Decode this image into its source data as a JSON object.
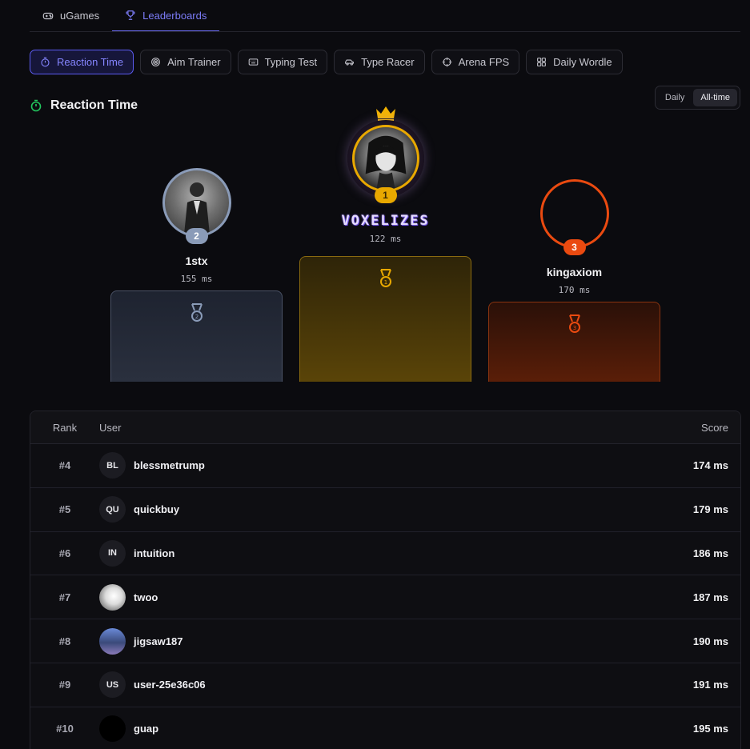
{
  "nav": {
    "items": [
      {
        "label": "uGames",
        "icon": "gamepad-icon"
      },
      {
        "label": "Leaderboards",
        "icon": "trophy-icon"
      }
    ]
  },
  "games": [
    {
      "label": "Reaction Time",
      "icon": "stopwatch-icon"
    },
    {
      "label": "Aim Trainer",
      "icon": "target-icon"
    },
    {
      "label": "Typing Test",
      "icon": "keyboard-icon"
    },
    {
      "label": "Type Racer",
      "icon": "car-icon"
    },
    {
      "label": "Arena FPS",
      "icon": "crosshair-icon"
    },
    {
      "label": "Daily Wordle",
      "icon": "grid-icon"
    }
  ],
  "section": {
    "title": "Reaction Time",
    "period_options": [
      "Daily",
      "All-time"
    ],
    "period_selected": "All-time"
  },
  "podium": {
    "first": {
      "rank": "1",
      "name": "VOXELIZES",
      "score": "122 ms"
    },
    "second": {
      "rank": "2",
      "name": "1stx",
      "score": "155 ms"
    },
    "third": {
      "rank": "3",
      "name": "kingaxiom",
      "score": "170 ms"
    }
  },
  "table": {
    "headers": {
      "rank": "Rank",
      "user": "User",
      "score": "Score"
    },
    "rows": [
      {
        "rank": "#4",
        "initials": "BL",
        "user": "blessmetrump",
        "score": "174 ms"
      },
      {
        "rank": "#5",
        "initials": "QU",
        "user": "quickbuy",
        "score": "179 ms"
      },
      {
        "rank": "#6",
        "initials": "IN",
        "user": "intuition",
        "score": "186 ms"
      },
      {
        "rank": "#7",
        "initials": "",
        "user": "twoo",
        "score": "187 ms"
      },
      {
        "rank": "#8",
        "initials": "",
        "user": "jigsaw187",
        "score": "190 ms"
      },
      {
        "rank": "#9",
        "initials": "US",
        "user": "user-25e36c06",
        "score": "191 ms"
      },
      {
        "rank": "#10",
        "initials": "",
        "user": "guap",
        "score": "195 ms"
      }
    ]
  },
  "colors": {
    "accent": "#5b5bf0",
    "gold": "#e8a800",
    "silver": "#8a9bb8",
    "bronze": "#ea4a10"
  }
}
